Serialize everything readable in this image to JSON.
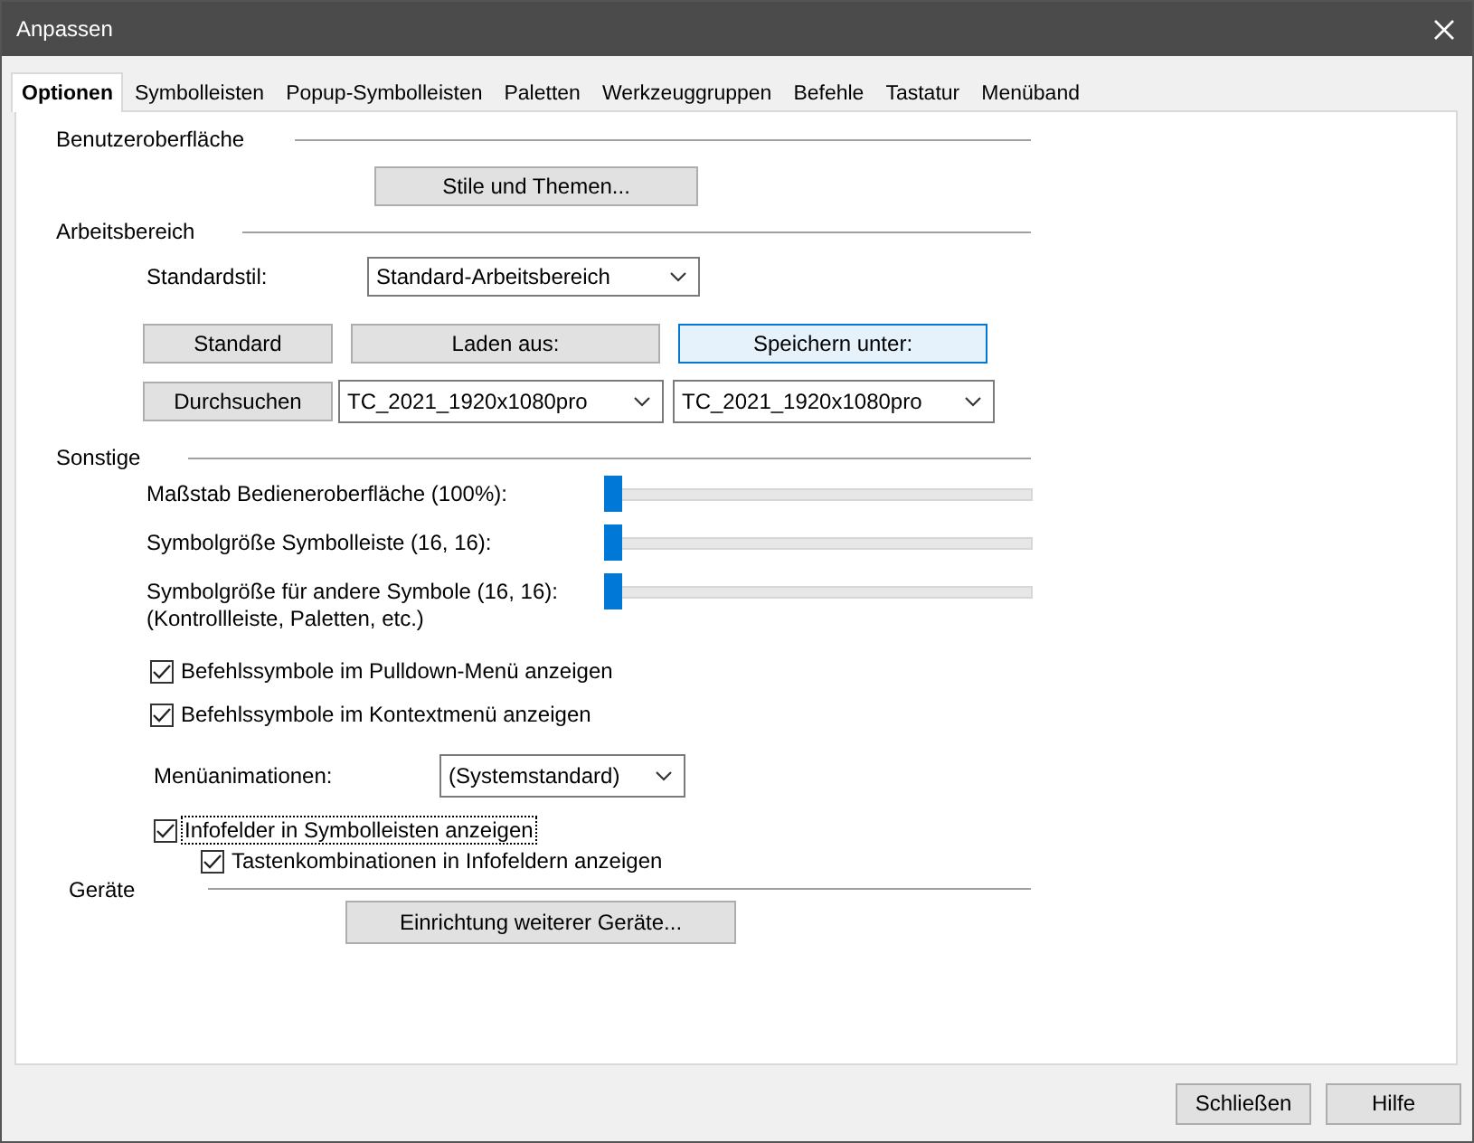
{
  "window": {
    "title": "Anpassen"
  },
  "tabs": [
    {
      "label": "Optionen",
      "selected": true
    },
    {
      "label": "Symbolleisten",
      "selected": false
    },
    {
      "label": "Popup-Symbolleisten",
      "selected": false
    },
    {
      "label": "Paletten",
      "selected": false
    },
    {
      "label": "Werkzeuggruppen",
      "selected": false
    },
    {
      "label": "Befehle",
      "selected": false
    },
    {
      "label": "Tastatur",
      "selected": false
    },
    {
      "label": "Menüband",
      "selected": false
    }
  ],
  "user_interface": {
    "title": "Benutzeroberfläche",
    "button": "Stile und Themen..."
  },
  "workspace": {
    "title": "Arbeitsbereich",
    "default_style": {
      "label": "Standardstil:",
      "value": "Standard-Arbeitsbereich"
    },
    "buttons": [
      {
        "label": "Standard",
        "highlighted": false
      },
      {
        "label": "Laden aus:",
        "highlighted": false
      },
      {
        "label": "Speichern unter:",
        "highlighted": true
      }
    ],
    "browse": "Durchsuchen",
    "load_from": "TC_2021_1920x1080pro",
    "save_to": "TC_2021_1920x1080pro"
  },
  "other": {
    "title": "Sonstige",
    "sliders": [
      {
        "label": "Maßstab Bedieneroberfläche (100%):",
        "level": 0
      },
      {
        "label": "Symbolgröße Symbolleiste (16, 16):",
        "level": 0
      },
      {
        "label": "Symbolgröße für andere Symbole (16, 16):\n(Kontrollleiste, Paletten, etc.)",
        "level": 0
      }
    ],
    "checkboxes": [
      {
        "label": "Befehlssymbole im Pulldown-Menü anzeigen",
        "checked": true
      },
      {
        "label": "Befehlssymbole im Kontextmenü anzeigen",
        "checked": true
      }
    ],
    "menu_animations": {
      "label": "Menüanimationen:",
      "value": "(Systemstandard)"
    },
    "tooltips": {
      "label": "Infofelder in Symbolleisten anzeigen",
      "checked": true,
      "focused": true,
      "children": [
        {
          "label": "Tastenkombinationen in Infofeldern anzeigen",
          "checked": true
        }
      ]
    }
  },
  "devices": {
    "title": "Geräte",
    "button": "Einrichtung weiterer Geräte..."
  },
  "footer_buttons": [
    "Schließen",
    "Hilfe"
  ]
}
